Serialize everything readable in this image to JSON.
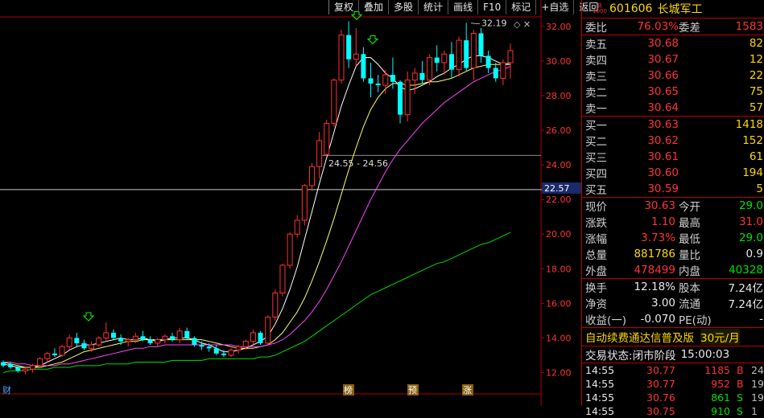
{
  "toolbar": {
    "items": [
      "复权",
      "叠加",
      "多股",
      "统计",
      "画线",
      "F10",
      "标记",
      "+自选",
      "返回"
    ]
  },
  "stock": {
    "code": "601606",
    "name": "长城军工",
    "logo_top": "R",
    "logo_bottom": "1000"
  },
  "order_book": {
    "ratio_label": "委比",
    "ratio_value": "76.03%",
    "diff_label": "委差",
    "diff_value": "1583",
    "asks": [
      {
        "label": "卖五",
        "price": "30.68",
        "vol": "82"
      },
      {
        "label": "卖四",
        "price": "30.67",
        "vol": "12"
      },
      {
        "label": "卖三",
        "price": "30.66",
        "vol": "22"
      },
      {
        "label": "卖二",
        "price": "30.65",
        "vol": "75"
      },
      {
        "label": "卖一",
        "price": "30.64",
        "vol": "57"
      }
    ],
    "bids": [
      {
        "label": "买一",
        "price": "30.63",
        "vol": "1418"
      },
      {
        "label": "买二",
        "price": "30.62",
        "vol": "152"
      },
      {
        "label": "买三",
        "price": "30.61",
        "vol": "61"
      },
      {
        "label": "买四",
        "price": "30.60",
        "vol": "194"
      },
      {
        "label": "买五",
        "price": "30.59",
        "vol": "5"
      }
    ]
  },
  "quote": {
    "rows": [
      {
        "l1": "现价",
        "v1": "30.63",
        "l2": "今开",
        "v2": "29.0"
      },
      {
        "l1": "涨跌",
        "v1": "1.10",
        "l2": "最高",
        "v2": "31.0"
      },
      {
        "l1": "涨幅",
        "v1": "3.73%",
        "l2": "最低",
        "v2": "29.0"
      },
      {
        "l1": "总量",
        "v1": "881786",
        "l2": "量比",
        "v2": "0.9"
      },
      {
        "l1": "外盘",
        "v1": "478499",
        "l2": "内盘",
        "v2": "40328"
      }
    ],
    "rows2": [
      {
        "l1": "换手",
        "v1": "12.18%",
        "l2": "股本",
        "v2": "7.24亿"
      },
      {
        "l1": "净资",
        "v1": "3.00",
        "l2": "流通",
        "v2": "7.24亿"
      },
      {
        "l1": "收益(一)",
        "v1": "-0.070",
        "l2": "PE(动)",
        "v2": "-"
      }
    ]
  },
  "ad": {
    "text": "自动续费通达信普及版",
    "price": "30元/月"
  },
  "status": {
    "label": "交易状态:",
    "state": "闭市阶段",
    "time": "15:00:03"
  },
  "ticks": [
    {
      "time": "14:55",
      "price": "30.77",
      "vol": "1185",
      "side": "B",
      "num": "24"
    },
    {
      "time": "14:55",
      "price": "30.77",
      "vol": "952",
      "side": "B",
      "num": "19"
    },
    {
      "time": "14:55",
      "price": "30.76",
      "vol": "861",
      "side": "S",
      "num": "19"
    },
    {
      "time": "14:55",
      "price": "30.75",
      "vol": "910",
      "side": "S",
      "num": "1"
    }
  ],
  "chart_data": {
    "type": "candlestick",
    "ylim": [
      11,
      33.2
    ],
    "y_ticks": [
      "32.00",
      "30.00",
      "28.00",
      "26.00",
      "24.00",
      "22.00",
      "20.00",
      "18.00",
      "16.00",
      "14.00",
      "12.00"
    ],
    "y_tick_values": [
      32,
      30,
      28,
      26,
      24,
      22,
      20,
      18,
      16,
      14,
      12
    ],
    "current_line": {
      "value": 22.57,
      "label": "22.57"
    },
    "ref_line": {
      "value": 24.55
    },
    "annotations": [
      {
        "text": "24.55 - 24.56",
        "value": 24.55
      },
      {
        "text": "32.19",
        "value": 32.19
      }
    ],
    "bottom_markers": [
      "财",
      "榜",
      "预",
      "涨"
    ],
    "candles": [
      [
        12.6,
        12.7,
        12.3,
        12.4
      ],
      [
        12.5,
        12.6,
        12.2,
        12.3
      ],
      [
        12.3,
        12.4,
        12.0,
        12.1
      ],
      [
        12.1,
        12.3,
        11.9,
        12.2
      ],
      [
        12.2,
        12.5,
        12.0,
        12.4
      ],
      [
        12.4,
        12.9,
        12.3,
        12.8
      ],
      [
        12.8,
        13.2,
        12.6,
        13.1
      ],
      [
        13.1,
        13.4,
        12.9,
        13.0
      ],
      [
        13.0,
        13.6,
        12.9,
        13.5
      ],
      [
        13.5,
        14.2,
        13.3,
        14.0
      ],
      [
        14.0,
        14.3,
        13.5,
        13.7
      ],
      [
        13.7,
        13.9,
        13.3,
        13.4
      ],
      [
        13.4,
        13.8,
        13.2,
        13.6
      ],
      [
        13.6,
        14.1,
        13.5,
        14.0
      ],
      [
        14.0,
        14.9,
        13.8,
        14.3
      ],
      [
        14.3,
        14.5,
        13.9,
        14.0
      ],
      [
        14.0,
        14.2,
        13.6,
        13.8
      ],
      [
        13.8,
        14.0,
        13.5,
        13.9
      ],
      [
        13.9,
        14.3,
        13.7,
        14.1
      ],
      [
        14.1,
        14.4,
        13.8,
        13.9
      ],
      [
        13.9,
        14.1,
        13.6,
        13.7
      ],
      [
        13.7,
        14.0,
        13.5,
        13.9
      ],
      [
        13.9,
        14.2,
        13.7,
        14.1
      ],
      [
        14.1,
        14.3,
        13.8,
        13.9
      ],
      [
        13.9,
        14.6,
        13.7,
        14.4
      ],
      [
        14.4,
        14.6,
        13.9,
        14.0
      ],
      [
        14.0,
        14.1,
        13.5,
        13.6
      ],
      [
        13.6,
        13.8,
        13.3,
        13.5
      ],
      [
        13.5,
        13.7,
        13.2,
        13.4
      ],
      [
        13.4,
        13.6,
        13.0,
        13.1
      ],
      [
        13.1,
        13.3,
        12.9,
        13.0
      ],
      [
        13.0,
        13.4,
        12.9,
        13.3
      ],
      [
        13.3,
        13.6,
        13.1,
        13.5
      ],
      [
        13.5,
        13.9,
        13.3,
        13.8
      ],
      [
        13.8,
        14.5,
        13.6,
        14.3
      ],
      [
        14.3,
        14.4,
        13.6,
        13.7
      ],
      [
        13.7,
        15.3,
        13.6,
        15.2
      ],
      [
        15.2,
        16.8,
        15.0,
        16.6
      ],
      [
        16.6,
        18.3,
        16.4,
        18.2
      ],
      [
        18.2,
        20.1,
        18.0,
        20.0
      ],
      [
        20.0,
        21.1,
        19.8,
        20.8
      ],
      [
        20.8,
        22.9,
        20.5,
        22.8
      ],
      [
        22.8,
        24.1,
        22.5,
        23.9
      ],
      [
        23.9,
        25.9,
        23.2,
        25.4
      ],
      [
        24.6,
        26.6,
        24.5,
        26.4
      ],
      [
        26.4,
        29.0,
        26.2,
        28.9
      ],
      [
        28.9,
        31.8,
        28.7,
        31.5
      ],
      [
        31.5,
        32.3,
        29.6,
        30.1
      ],
      [
        30.1,
        31.9,
        29.7,
        30.4
      ],
      [
        30.4,
        30.8,
        28.8,
        29.0
      ],
      [
        29.0,
        29.9,
        27.9,
        28.7
      ],
      [
        28.7,
        29.2,
        28.2,
        28.6
      ],
      [
        28.6,
        29.5,
        28.1,
        29.2
      ],
      [
        29.2,
        30.2,
        28.4,
        28.8
      ],
      [
        28.8,
        28.9,
        26.4,
        26.9
      ],
      [
        26.9,
        29.4,
        26.5,
        28.9
      ],
      [
        28.9,
        29.6,
        28.1,
        29.3
      ],
      [
        29.3,
        30.0,
        28.7,
        28.9
      ],
      [
        28.9,
        30.4,
        28.6,
        30.2
      ],
      [
        30.2,
        30.9,
        29.4,
        29.9
      ],
      [
        29.9,
        30.6,
        29.2,
        30.4
      ],
      [
        30.4,
        31.1,
        29.0,
        29.5
      ],
      [
        29.5,
        31.4,
        29.1,
        31.2
      ],
      [
        31.2,
        32.2,
        29.4,
        29.6
      ],
      [
        29.6,
        31.8,
        28.9,
        31.6
      ],
      [
        31.6,
        31.9,
        29.9,
        30.3
      ],
      [
        30.3,
        30.6,
        29.3,
        29.6
      ],
      [
        29.6,
        29.9,
        28.8,
        29.0
      ],
      [
        29.0,
        30.1,
        28.6,
        29.9
      ],
      [
        29.9,
        31.0,
        29.0,
        30.6
      ]
    ],
    "ma_series": [
      {
        "color": "#ffffff",
        "values": [
          12.5,
          12.4,
          12.3,
          12.3,
          12.3,
          12.4,
          12.6,
          12.8,
          13.0,
          13.3,
          13.5,
          13.6,
          13.6,
          13.7,
          13.8,
          13.9,
          14.0,
          13.9,
          13.9,
          14.0,
          13.9,
          13.8,
          13.9,
          14.0,
          14.0,
          14.0,
          13.9,
          13.7,
          13.6,
          13.4,
          13.2,
          13.2,
          13.3,
          13.4,
          13.6,
          13.8,
          14.1,
          14.8,
          15.7,
          16.8,
          18.1,
          19.7,
          21.3,
          22.9,
          24.4,
          25.9,
          27.4,
          28.6,
          29.7,
          30.2,
          30.2,
          29.8,
          29.3,
          29.0,
          28.5,
          28.3,
          28.4,
          28.6,
          28.8,
          29.1,
          29.3,
          29.6,
          29.8,
          30.1,
          30.3,
          30.3,
          30.2,
          30.0,
          29.8,
          29.8
        ]
      },
      {
        "color": "#ffff66",
        "values": [
          12.6,
          12.5,
          12.4,
          12.3,
          12.3,
          12.3,
          12.4,
          12.5,
          12.6,
          12.8,
          13.0,
          13.2,
          13.3,
          13.4,
          13.5,
          13.6,
          13.7,
          13.8,
          13.8,
          13.9,
          13.9,
          13.9,
          13.9,
          13.9,
          13.9,
          13.9,
          13.9,
          13.9,
          13.8,
          13.7,
          13.6,
          13.5,
          13.4,
          13.4,
          13.4,
          13.5,
          13.6,
          13.9,
          14.3,
          14.9,
          15.5,
          16.3,
          17.3,
          18.4,
          19.6,
          20.9,
          22.3,
          23.7,
          25.0,
          26.2,
          27.2,
          27.9,
          28.4,
          28.7,
          28.7,
          28.6,
          28.6,
          28.7,
          28.8,
          28.8,
          28.9,
          29.0,
          29.2,
          29.4,
          29.6,
          29.7,
          29.8,
          29.8,
          29.8,
          29.9
        ]
      },
      {
        "color": "#ff44ff",
        "values": [
          12.6,
          12.6,
          12.5,
          12.5,
          12.4,
          12.4,
          12.4,
          12.4,
          12.5,
          12.5,
          12.6,
          12.7,
          12.8,
          12.9,
          13.0,
          13.1,
          13.2,
          13.3,
          13.4,
          13.4,
          13.5,
          13.5,
          13.6,
          13.6,
          13.6,
          13.6,
          13.6,
          13.6,
          13.6,
          13.6,
          13.6,
          13.6,
          13.5,
          13.5,
          13.5,
          13.5,
          13.6,
          13.7,
          13.9,
          14.2,
          14.6,
          15.0,
          15.5,
          16.1,
          16.8,
          17.6,
          18.4,
          19.3,
          20.2,
          21.1,
          22.0,
          22.8,
          23.6,
          24.3,
          24.9,
          25.4,
          25.9,
          26.4,
          26.8,
          27.2,
          27.6,
          27.9,
          28.2,
          28.5,
          28.8,
          29.0,
          29.2,
          29.4,
          29.5,
          29.7
        ]
      },
      {
        "color": "#00dd00",
        "values": [
          12.0,
          12.1,
          12.1,
          12.1,
          12.2,
          12.2,
          12.2,
          12.3,
          12.3,
          12.3,
          12.4,
          12.4,
          12.4,
          12.4,
          12.5,
          12.5,
          12.5,
          12.5,
          12.6,
          12.6,
          12.6,
          12.6,
          12.6,
          12.7,
          12.7,
          12.7,
          12.7,
          12.7,
          12.8,
          12.8,
          12.8,
          12.8,
          12.8,
          12.8,
          12.8,
          12.9,
          12.9,
          13.0,
          13.2,
          13.4,
          13.6,
          13.8,
          14.1,
          14.4,
          14.7,
          15.0,
          15.3,
          15.6,
          15.9,
          16.2,
          16.5,
          16.7,
          16.9,
          17.1,
          17.3,
          17.5,
          17.7,
          17.9,
          18.1,
          18.3,
          18.4,
          18.6,
          18.8,
          19.0,
          19.2,
          19.4,
          19.5,
          19.7,
          19.9,
          20.1
        ]
      }
    ]
  }
}
